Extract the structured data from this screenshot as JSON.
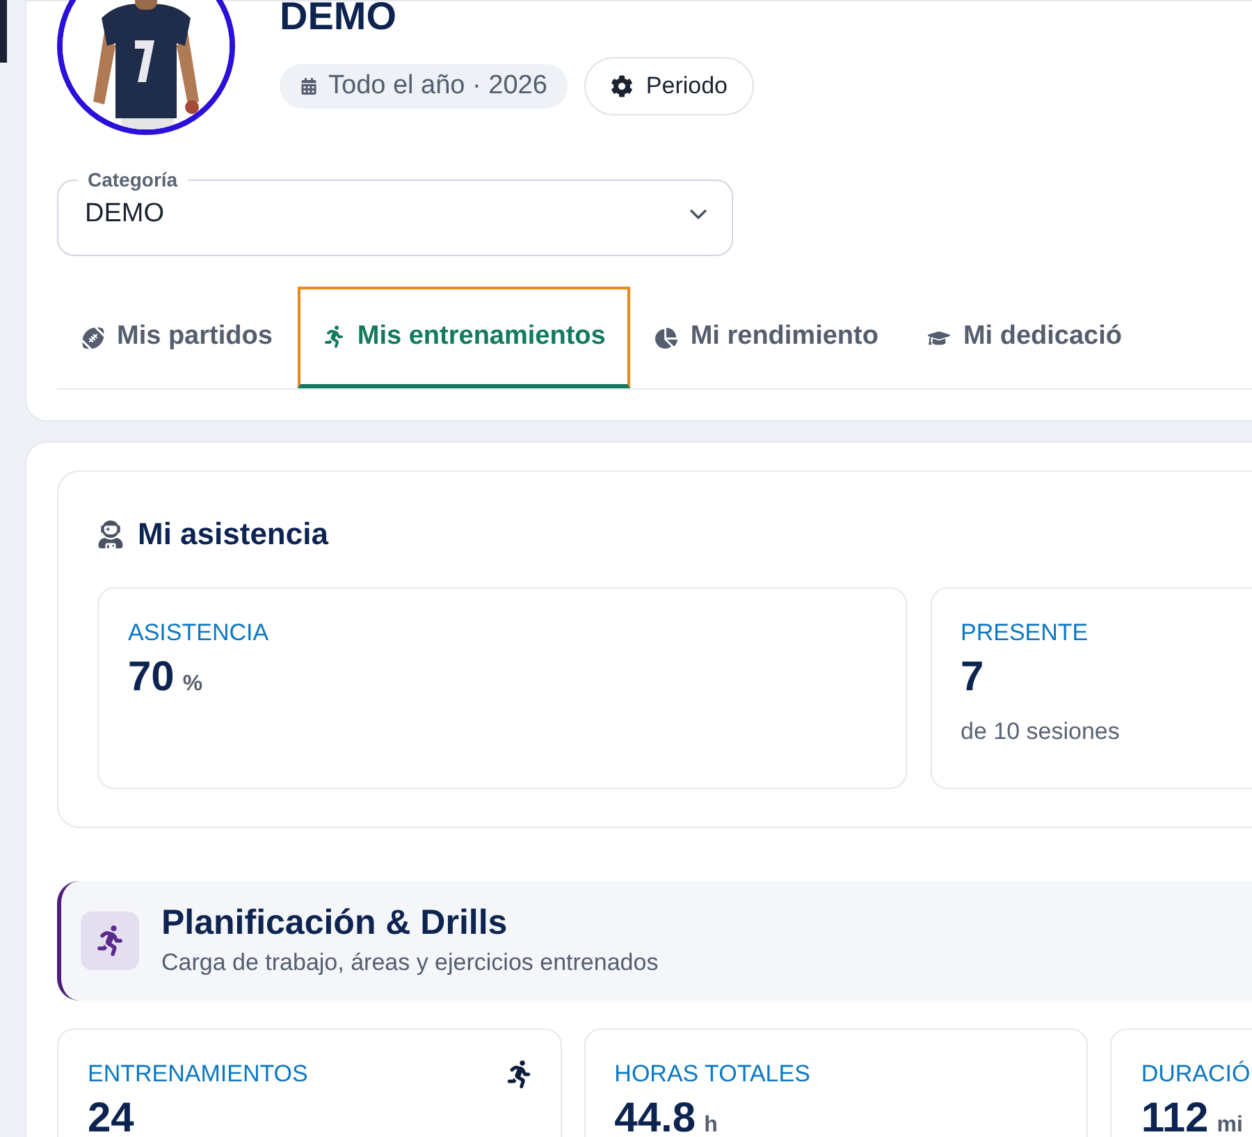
{
  "header": {
    "title": "DEMO",
    "period_chip": "Todo el año · 2026",
    "period_button": "Periodo"
  },
  "category_select": {
    "label": "Categoría",
    "value": "DEMO"
  },
  "tabs": [
    {
      "label": "Mis partidos",
      "selected": false
    },
    {
      "label": "Mis entrenamientos",
      "selected": true
    },
    {
      "label": "Mi rendimiento",
      "selected": false
    },
    {
      "label": "Mi dedicació",
      "selected": false
    }
  ],
  "attendance": {
    "title": "Mi asistencia",
    "stats": [
      {
        "label": "ASISTENCIA",
        "value": "70",
        "unit": "%"
      },
      {
        "label": "PRESENTE",
        "value": "7",
        "note": "de 10 sesiones"
      }
    ]
  },
  "planning": {
    "title": "Planificación & Drills",
    "subtitle": "Carga de trabajo, áreas y ejercicios entrenados",
    "stats": [
      {
        "label": "ENTRENAMIENTOS",
        "value": "24"
      },
      {
        "label": "HORAS TOTALES",
        "value": "44.8",
        "unit": "h"
      },
      {
        "label": "DURACIÓ",
        "value": "112",
        "unit": "mi"
      }
    ]
  }
}
